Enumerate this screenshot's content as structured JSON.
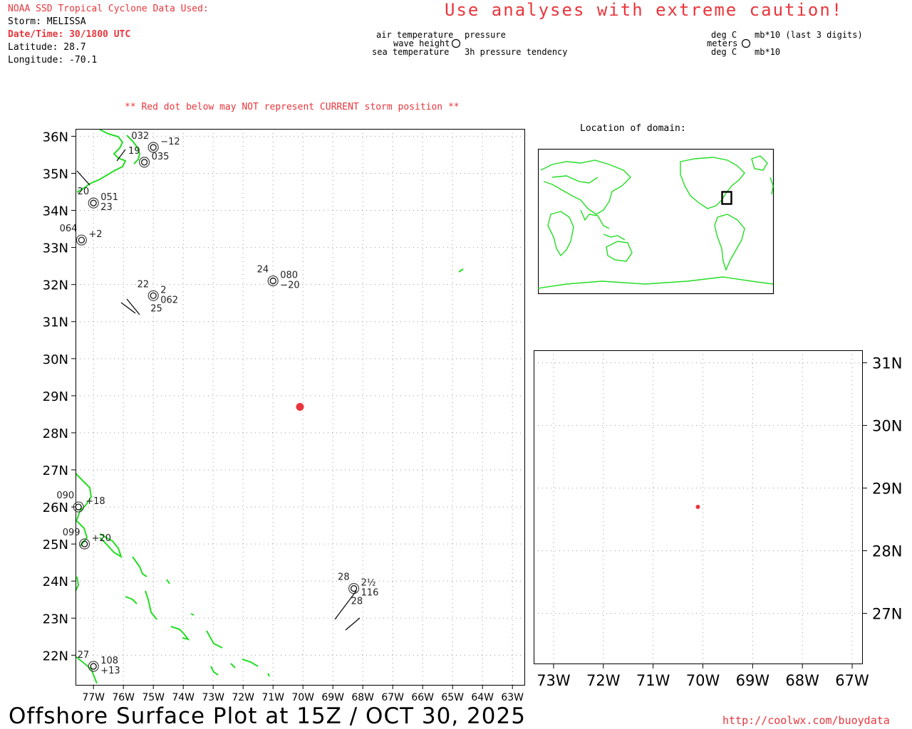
{
  "header": {
    "source": "NOAA SSD Tropical Cyclone Data Used:",
    "storm": "Storm: MELISSA",
    "datetime": "Date/Time: 30/1800 UTC",
    "latitude": "Latitude: 28.7",
    "longitude": "Longitude: -70.1"
  },
  "caution": "Use analyses with extreme caution!",
  "legend": {
    "air_temp": "air temperature",
    "wave_height": "wave height",
    "sea_temp": "sea temperature",
    "pressure": "pressure",
    "tendency": "3h pressure tendency",
    "units_air": "deg C",
    "units_wave": "meters",
    "units_sea": "deg C",
    "units_pressure": "mb*10 (last 3 digits)",
    "units_tendency": "mb*10"
  },
  "red_dot_note": "** Red dot below may NOT represent CURRENT storm position **",
  "inset_title": "Location of domain:",
  "footer": {
    "title": "Offshore Surface Plot at 15Z / OCT 30, 2025",
    "url": "http://coolwx.com/buoydata"
  },
  "colors": {
    "accent_red": "#e8363c",
    "coast_green": "#22dd22",
    "station": "#000000"
  },
  "map": {
    "lat_labels": [
      "36N",
      "35N",
      "34N",
      "33N",
      "32N",
      "31N",
      "30N",
      "29N",
      "28N",
      "27N",
      "26N",
      "25N",
      "24N",
      "23N",
      "22N"
    ],
    "lon_labels": [
      "77W",
      "76W",
      "75W",
      "74W",
      "73W",
      "72W",
      "71W",
      "70W",
      "69W",
      "68W",
      "67W",
      "66W",
      "65W",
      "64W",
      "63W"
    ],
    "lat_range": [
      21.2,
      36.2
    ],
    "lon_range": [
      -77.6,
      -62.6
    ],
    "storm_position": {
      "lat": 28.7,
      "lon": -70.1
    },
    "stations": [
      {
        "lat": 32.1,
        "lon": -71.0,
        "labels": [
          "24",
          "080",
          "−20"
        ]
      },
      {
        "lat": 31.7,
        "lon": -75.0,
        "labels": [
          "22",
          "2",
          "062",
          "25"
        ]
      },
      {
        "lat": 33.2,
        "lon": -77.4,
        "labels": [
          "064",
          "+2"
        ]
      },
      {
        "lat": 34.2,
        "lon": -77.0,
        "labels": [
          "20",
          "051",
          "23"
        ]
      },
      {
        "lat": 35.3,
        "lon": -75.3,
        "labels": [
          "19",
          "035"
        ]
      },
      {
        "lat": 35.7,
        "lon": -75.0,
        "labels": [
          "032",
          "−12"
        ]
      },
      {
        "lat": 26.0,
        "lon": -77.5,
        "labels": [
          "090",
          "+18"
        ]
      },
      {
        "lat": 25.0,
        "lon": -77.3,
        "labels": [
          "099",
          "+20"
        ]
      },
      {
        "lat": 21.7,
        "lon": -77.0,
        "labels": [
          "27",
          "108",
          "+13"
        ]
      },
      {
        "lat": 23.8,
        "lon": -68.3,
        "labels": [
          "28",
          "2½",
          "116",
          "28"
        ]
      }
    ]
  },
  "zoom": {
    "lat_labels": [
      "31N",
      "30N",
      "29N",
      "28N",
      "27N"
    ],
    "lon_labels": [
      "73W",
      "72W",
      "71W",
      "70W",
      "69W",
      "68W",
      "67W"
    ],
    "lat_range": [
      26.2,
      31.2
    ],
    "lon_range": [
      -73.4,
      -66.8
    ],
    "storm_position": {
      "lat": 28.7,
      "lon": -70.1
    }
  }
}
